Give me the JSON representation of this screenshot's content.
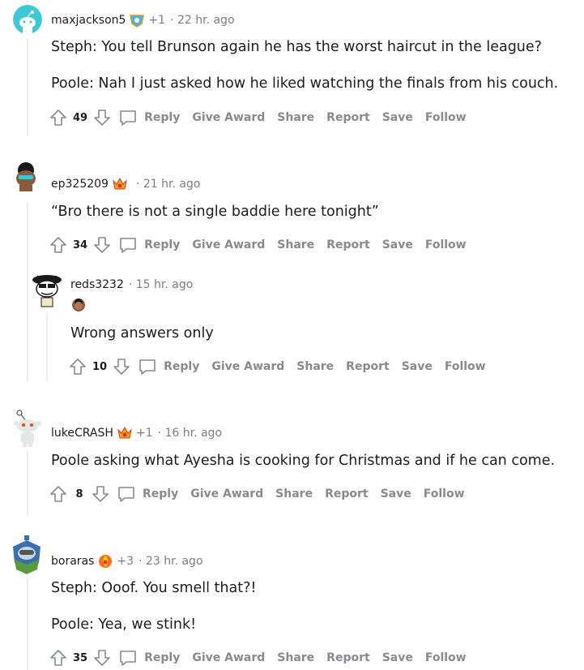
{
  "colors": {
    "accent_meta": "#7c7c7c",
    "action_gray": "#878a8c",
    "thread_line": "#edeff1"
  },
  "actions": {
    "reply": "Reply",
    "give_award": "Give Award",
    "share": "Share",
    "report": "Report",
    "save": "Save",
    "follow": "Follow"
  },
  "comments": [
    {
      "username": "maxjackson5",
      "awards": "+1",
      "time": "· 22 hr. ago",
      "lines": [
        "Steph: You tell Brunson again he has the worst haircut in the league?",
        "Poole: Nah I just asked how he liked watching the finals from his couch."
      ],
      "score": "49"
    },
    {
      "username": "ep325209",
      "awards": "",
      "time": "· 21 hr. ago",
      "lines": [
        "“Bro there is not a single baddie here tonight”"
      ],
      "score": "34"
    },
    {
      "username": "reds3232",
      "awards": "",
      "time": "· 15 hr. ago",
      "lines": [
        "Wrong answers only"
      ],
      "score": "10"
    },
    {
      "username": "lukeCRASH",
      "awards": "+1",
      "time": "· 16 hr. ago",
      "lines": [
        "Poole asking what Ayesha is cooking for Christmas and if he can come."
      ],
      "score": "8"
    },
    {
      "username": "boraras",
      "awards": "+3",
      "time": "· 23 hr. ago",
      "lines": [
        "Steph: Ooof. You smell that?!",
        "Poole: Yea, we stink!"
      ],
      "score": "35"
    }
  ]
}
